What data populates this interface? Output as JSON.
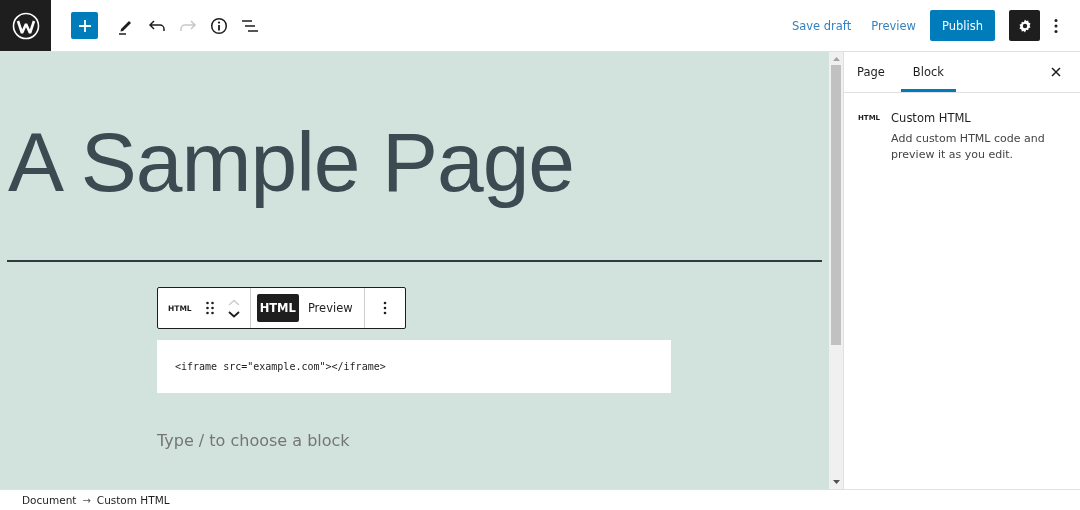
{
  "header": {
    "redo_disabled": true,
    "save_draft": "Save draft",
    "preview": "Preview",
    "publish": "Publish",
    "settings_active": true
  },
  "canvas": {
    "title": "A Sample Page",
    "block_toolbar": {
      "block_icon": "HTML",
      "move_up_disabled": true,
      "modes": [
        {
          "label": "HTML",
          "selected": true
        },
        {
          "label": "Preview",
          "selected": false
        }
      ]
    },
    "code": "<iframe src=\"example.com\"></iframe>",
    "appender_placeholder": "Type / to choose a block"
  },
  "sidebar": {
    "tabs": [
      {
        "label": "Page",
        "selected": false
      },
      {
        "label": "Block",
        "selected": true
      }
    ],
    "block_card": {
      "icon": "HTML",
      "title": "Custom HTML",
      "description": "Add custom HTML code and preview it as you edit."
    }
  },
  "breadcrumb": {
    "items": [
      "Document",
      "Custom HTML"
    ],
    "separator": "→"
  }
}
